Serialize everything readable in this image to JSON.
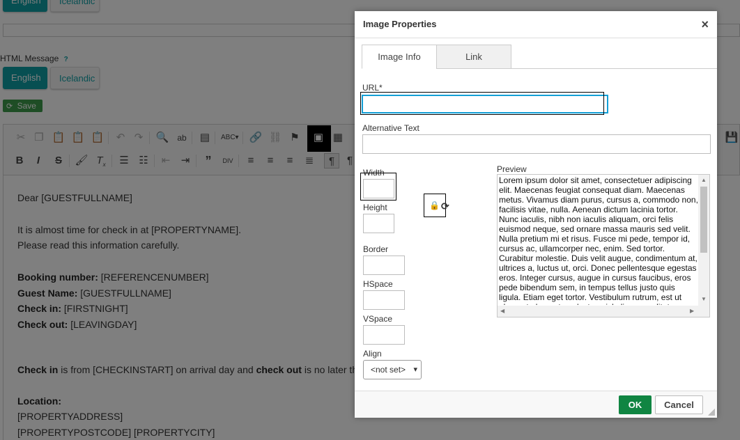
{
  "background": {
    "top_lang_buttons": [
      "English",
      "Icelandic"
    ],
    "html_message_label": "HTML Message",
    "help_mark": "?",
    "lang_buttons": [
      "English",
      "Icelandic"
    ],
    "save_label": "Save",
    "toolbar_row1": [
      "scissors-icon",
      "copy-icon",
      "paste-icon",
      "paste-text-icon",
      "paste-word-icon",
      "undo-icon",
      "redo-icon",
      "find-icon",
      "replace-icon",
      "templates-icon",
      "spellcheck-icon",
      "link-icon",
      "unlink-icon",
      "anchor-icon",
      "image-icon",
      "table-icon"
    ],
    "toolbar_row2": [
      "bold-icon",
      "italic-icon",
      "strike-icon",
      "format-painter-icon",
      "clear-format-icon",
      "numbered-list-icon",
      "bullet-list-icon",
      "outdent-icon",
      "indent-icon",
      "blockquote-icon",
      "div-icon",
      "align-left-icon",
      "align-center-icon",
      "align-right-icon",
      "justify-icon",
      "ltr-icon",
      "rtl-icon"
    ],
    "editor_lines": {
      "greeting": "Dear [GUESTFULLNAME]",
      "line1": "It is almost time for check in at [PROPERTYNAME].",
      "line2": "Please read this information carefully.",
      "booking_label": "Booking number:",
      "booking_value": " [REFERENCENUMBER]",
      "guest_label": "Guest Name:",
      "guest_value": " [GUESTFULLNAME]",
      "checkin_label": "Check in:",
      "checkin_value": " [FIRSTNIGHT]",
      "checkout_label": "Check out:",
      "checkout_value": " [LEAVINGDAY]",
      "checkin_sentence_b1": "Check in",
      "checkin_sentence_mid": " is from [CHECKINSTART] on arrival day and ",
      "checkin_sentence_b2": "check out",
      "checkin_sentence_end": " is no later th",
      "location_label": "Location:",
      "address": "[PROPERTYADDRESS]",
      "postcode_city": "[PROPERTYPOSTCODE] [PROPERTYCITY]"
    }
  },
  "dialog": {
    "title": "Image Properties",
    "close_glyph": "×",
    "tabs": [
      {
        "label": "Image Info"
      },
      {
        "label": "Link"
      }
    ],
    "url_label": "URL*",
    "url_value": "",
    "alt_label": "Alternative Text",
    "alt_value": "",
    "width_label": "Width",
    "height_label": "Height",
    "border_label": "Border",
    "hspace_label": "HSpace",
    "vspace_label": "VSpace",
    "align_label": "Align",
    "align_value": "<not set>",
    "preview_label": "Preview",
    "preview_text": "Lorem ipsum dolor sit amet, consectetuer adipiscing elit. Maecenas feugiat consequat diam. Maecenas metus. Vivamus diam purus, cursus a, commodo non, facilisis vitae, nulla. Aenean dictum lacinia tortor. Nunc iaculis, nibh non iaculis aliquam, orci felis euismod neque, sed ornare massa mauris sed velit. Nulla pretium mi et risus. Fusce mi pede, tempor id, cursus ac, ullamcorper nec, enim. Sed tortor. Curabitur molestie. Duis velit augue, condimentum at, ultrices a, luctus ut, orci. Donec pellentesque egestas eros. Integer cursus, augue in cursus faucibus, eros pede bibendum sem, in tempus tellus justo quis ligula. Etiam eget tortor. Vestibulum rutrum, est ut placerat elementum, lectus nisl aliquam velit, tempor aliquam eros nunc nonummy metus.",
    "ok_label": "OK",
    "cancel_label": "Cancel"
  }
}
